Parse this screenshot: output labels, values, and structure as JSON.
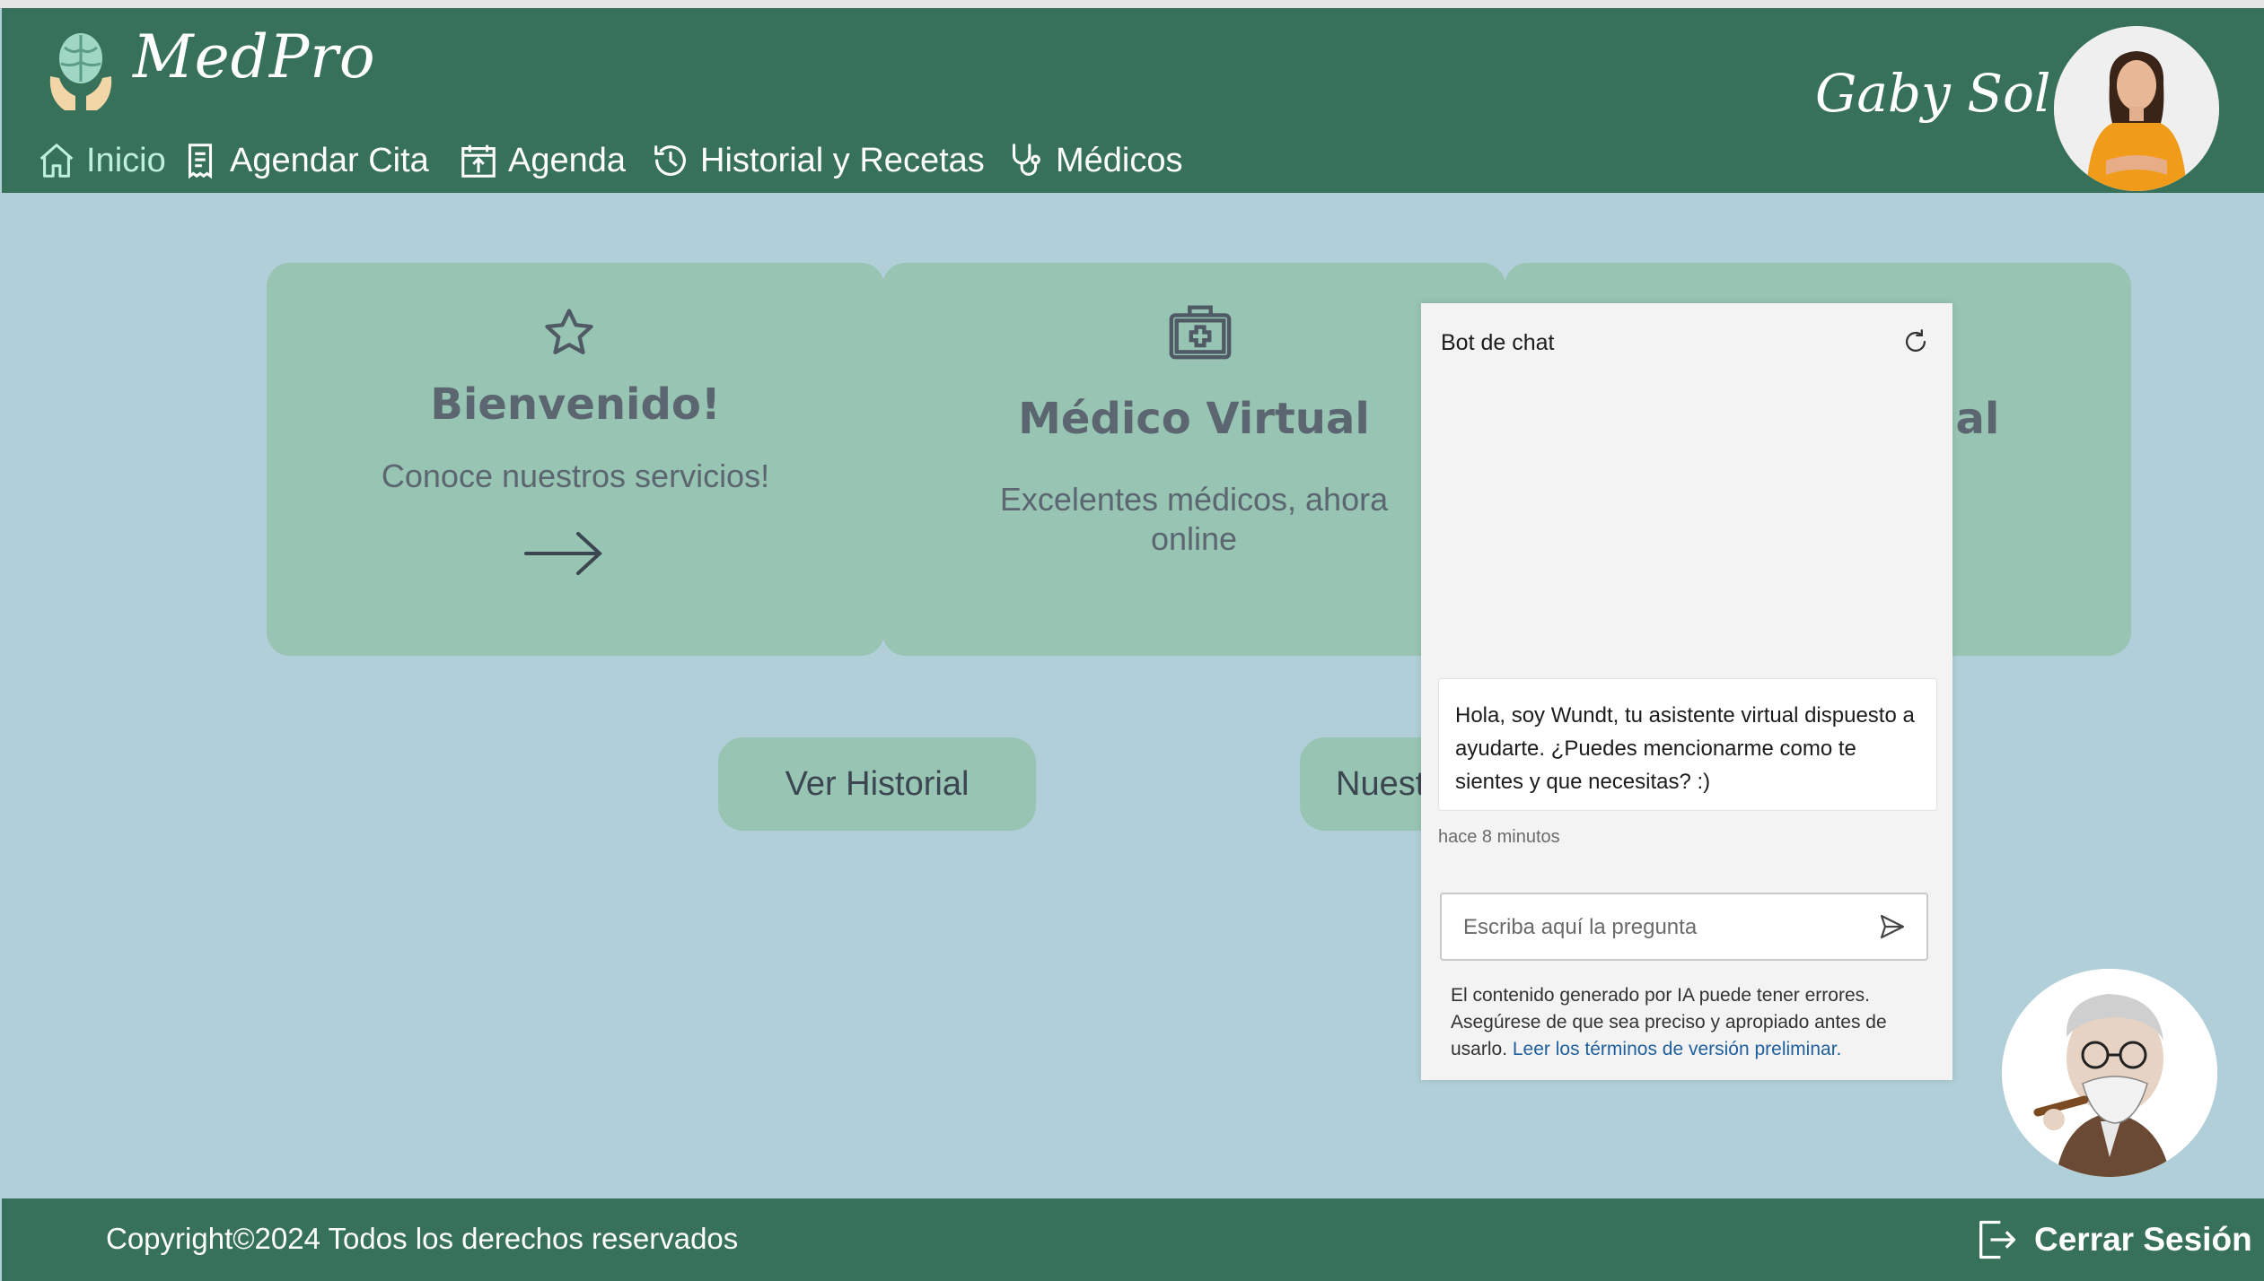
{
  "app": {
    "brand": "MedPro",
    "user_name": "Gaby Sol"
  },
  "nav": {
    "items": [
      {
        "label": "Inicio",
        "icon": "home-icon",
        "active": true
      },
      {
        "label": "Agendar Cita",
        "icon": "document-icon"
      },
      {
        "label": "Agenda",
        "icon": "calendar-icon"
      },
      {
        "label": "Historial y Recetas",
        "icon": "history-icon"
      },
      {
        "label": "Médicos",
        "icon": "stethoscope-icon"
      }
    ]
  },
  "cards": [
    {
      "title": "Bienvenido!",
      "text": "Conoce nuestros servicios!",
      "icon": "star-icon",
      "arrow": "arrow-right-icon"
    },
    {
      "title": "Médico Virtual",
      "text": "Excelentes médicos, ahora online",
      "icon": "medical-kit-icon"
    },
    {
      "title_visible": "ial",
      "text_visible": "!"
    }
  ],
  "buttons": {
    "history": "Ver Historial",
    "second_visible": "Nuest"
  },
  "chat": {
    "title": "Bot de chat",
    "message": "Hola, soy Wundt, tu asistente virtual dispuesto a ayudarte. ¿Puedes mencionarme como te sientes y que necesitas? :)",
    "timestamp": "hace 8 minutos",
    "input_placeholder": "Escriba aquí la pregunta",
    "disclaimer": "El contenido generado por IA puede tener errores. Asegúrese de que sea preciso y apropiado antes de usarlo.",
    "disclaimer_link": "Leer los términos de versión preliminar."
  },
  "footer": {
    "copyright": "Copyright©2024 Todos los derechos reservados",
    "logout": "Cerrar Sesión"
  },
  "colors": {
    "header": "#37715a",
    "background": "#b1cfd8",
    "card": "#98c4b3",
    "card_text": "#5b6670",
    "active_nav": "#bff0de",
    "link": "#1f5f9e"
  }
}
